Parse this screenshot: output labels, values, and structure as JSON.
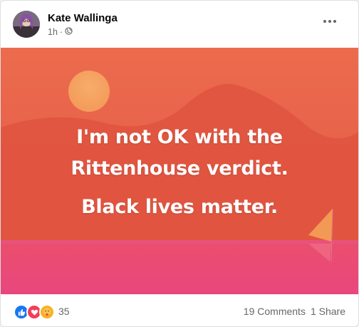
{
  "post": {
    "author": "Kate Wallinga",
    "time": "1h",
    "separator": "·",
    "privacy_icon": "globe-icon",
    "more_icon": "more-dots-icon",
    "text_lines": [
      "I'm not OK with the",
      "Rittenhouse verdict."
    ],
    "text_line3": "Black lives matter.",
    "background": {
      "top_color": "#e8604a",
      "bottom_color": "#e8457a",
      "sun_color": "#f5a05e"
    }
  },
  "footer": {
    "reactions": [
      "like-icon",
      "love-icon",
      "care-icon"
    ],
    "reaction_count": "35",
    "comments": "19 Comments",
    "shares": "1 Share"
  }
}
